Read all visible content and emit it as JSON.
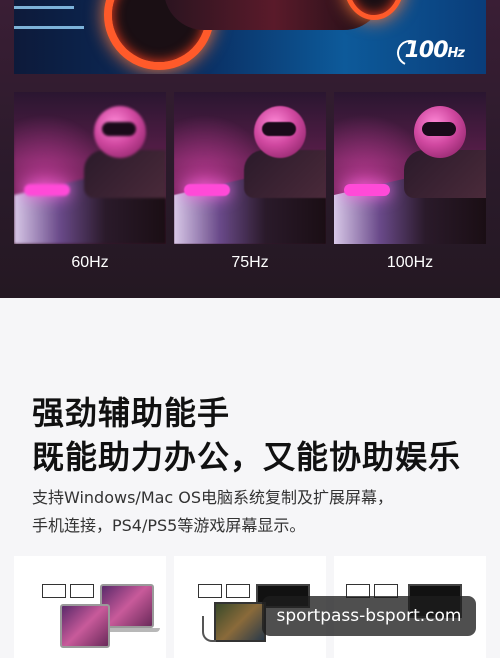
{
  "banner": {
    "badge_value": "100",
    "badge_unit": "Hz",
    "panels": [
      {
        "label": "60Hz"
      },
      {
        "label": "75Hz"
      },
      {
        "label": "100Hz"
      }
    ]
  },
  "feature": {
    "headline_line1": "强劲辅助能手",
    "headline_line2": "既能助力办公，又能协助娱乐",
    "desc_line1": "支持Windows/Mac  OS电脑系统复制及扩展屏幕，",
    "desc_line2": "手机连接，PS4/PS5等游戏屏幕显示。"
  },
  "watermark": {
    "text": "sportpass-bsport.com"
  },
  "colors": {
    "banner_bg": "#2a1a2a",
    "text_dark": "#111111",
    "accent_pink": "#ff4ad8"
  }
}
